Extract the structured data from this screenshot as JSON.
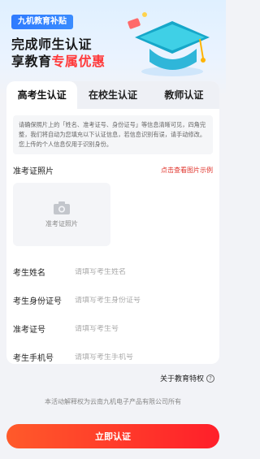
{
  "hero": {
    "badge": "九机教育补贴",
    "line1": "完成师生认证",
    "line2_prefix": "享教育",
    "line2_accent": "专属优惠"
  },
  "tabs": [
    {
      "label": "高考生认证",
      "active": true
    },
    {
      "label": "在校生认证",
      "active": false
    },
    {
      "label": "教师认证",
      "active": false
    }
  ],
  "notice": "请确保照片上的「姓名、准考证号、身份证号」等信息清晰可见，四角完整，我们将自动为您填充以下认证信息，若信息识别有误，请手动修改。您上传的个人信息仅用于识别身份。",
  "photo": {
    "label": "准考证照片",
    "example_link": "点击查看图片示例",
    "upload_text": "准考证照片"
  },
  "fields": [
    {
      "label": "考生姓名",
      "placeholder": "请填写考生姓名"
    },
    {
      "label": "考生身份证号",
      "placeholder": "请填写考生身份证号"
    },
    {
      "label": "准考证号",
      "placeholder": "请填写考生号"
    },
    {
      "label": "考生手机号",
      "placeholder": "请填写考生手机号"
    }
  ],
  "privilege_link": "关于教育特权",
  "rights_text": "本活动解释权为云南九机电子产品有限公司所有",
  "submit_label": "立即认证",
  "colors": {
    "accent": "#ff3a3a",
    "brand_blue": "#2f7bff",
    "submit_start": "#ff5a2a",
    "submit_end": "#ff1f2a"
  }
}
